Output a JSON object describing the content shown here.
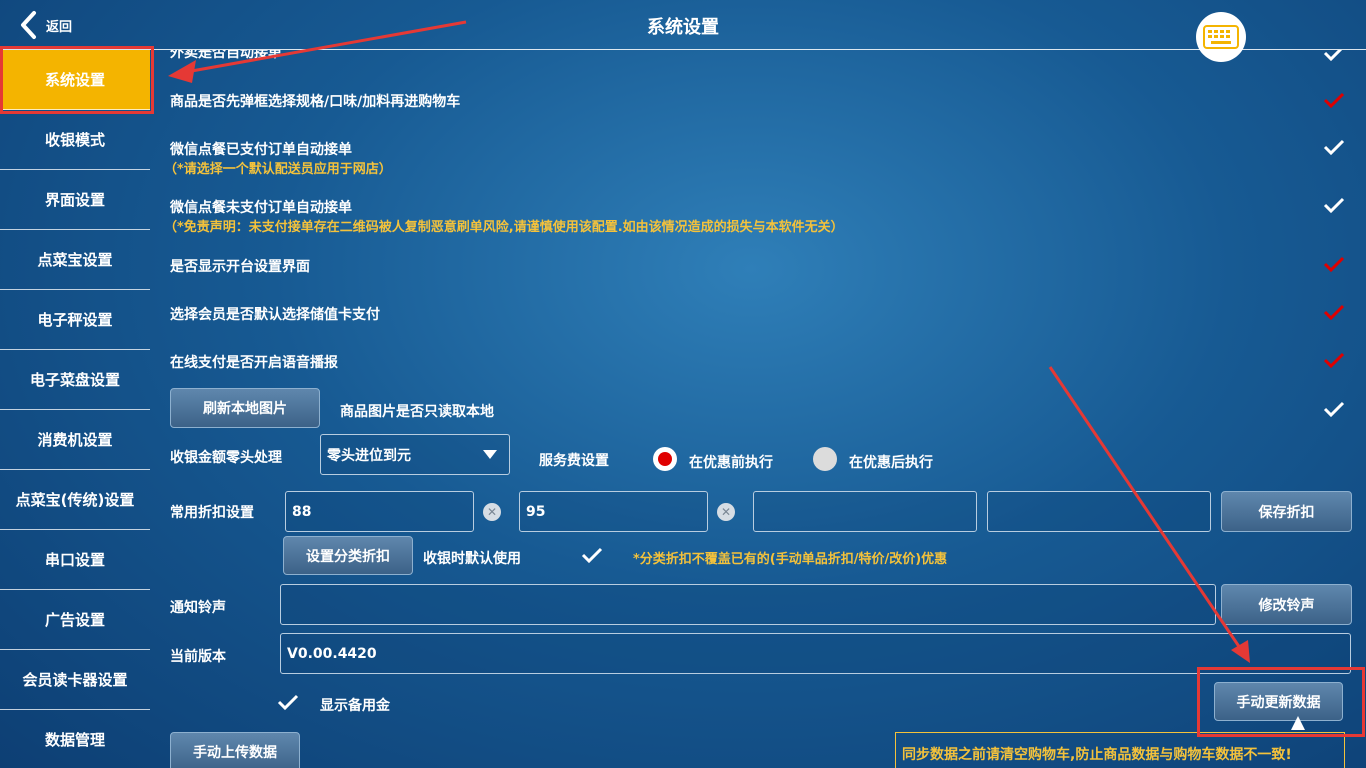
{
  "header": {
    "back_label": "返回",
    "title": "系统设置"
  },
  "sidebar": {
    "items": [
      {
        "label": "系统设置"
      },
      {
        "label": "收银模式"
      },
      {
        "label": "界面设置"
      },
      {
        "label": "点菜宝设置"
      },
      {
        "label": "电子秤设置"
      },
      {
        "label": "电子菜盘设置"
      },
      {
        "label": "消费机设置"
      },
      {
        "label": "点菜宝(传统)设置"
      },
      {
        "label": "串口设置"
      },
      {
        "label": "广告设置"
      },
      {
        "label": "会员读卡器设置"
      },
      {
        "label": "数据管理"
      }
    ]
  },
  "settings": {
    "row0": {
      "label": "外卖是否自动接单",
      "checked": false
    },
    "row1": {
      "label": "商品是否先弹框选择规格/口味/加料再进购物车",
      "checked": true
    },
    "row2": {
      "label": "微信点餐已支付订单自动接单",
      "note": "（*请选择一个默认配送员应用于网店）",
      "checked": false
    },
    "row3": {
      "label": "微信点餐未支付订单自动接单",
      "note": "（*免责声明：未支付接单存在二维码被人复制恶意刷单风险,请谨慎使用该配置.如由该情况造成的损失与本软件无关）",
      "checked": false
    },
    "row4": {
      "label": "是否显示开台设置界面",
      "checked": true
    },
    "row5": {
      "label": "选择会员是否默认选择储值卡支付",
      "checked": true
    },
    "row6": {
      "label": "在线支付是否开启语音播报",
      "checked": true
    },
    "row7": {
      "button": "刷新本地图片",
      "label": "商品图片是否只读取本地",
      "checked": false
    }
  },
  "rounding": {
    "label": "收银金额零头处理",
    "selected": "零头进位到元"
  },
  "service_fee": {
    "label": "服务费设置",
    "option_before": "在优惠前执行",
    "option_after": "在优惠后执行",
    "selected": "before"
  },
  "discount": {
    "label": "常用折扣设置",
    "values": [
      "88",
      "95",
      "",
      ""
    ],
    "save_button": "保存折扣",
    "category_button": "设置分类折扣",
    "default_label": "收银时默认使用",
    "warning": "*分类折扣不覆盖已有的(手动单品折扣/特价/改价)优惠"
  },
  "ringtone": {
    "label": "通知铃声",
    "value": "",
    "button": "修改铃声"
  },
  "version": {
    "label": "当前版本",
    "value": "V0.00.4420"
  },
  "reserve": {
    "label": "显示备用金",
    "checked": true
  },
  "manual_update_button": "手动更新数据",
  "manual_upload_button": "手动上传数据",
  "sync_warning": "同步数据之前请清空购物车,防止商品数据与购物车数据不一致!",
  "colors": {
    "active_tab": "#f4b400",
    "check_on": "#e00000",
    "check_off": "#ffffff",
    "note": "#f4c23b",
    "annotation": "#e53935"
  }
}
